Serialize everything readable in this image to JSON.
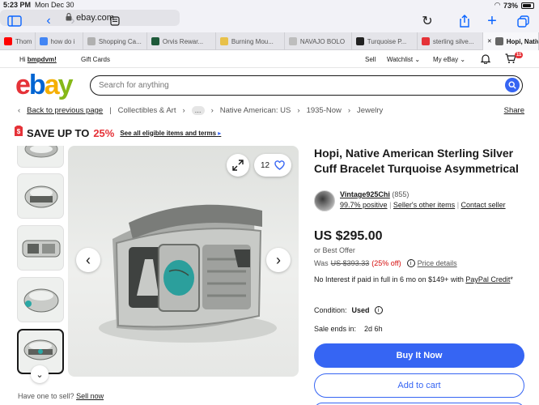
{
  "status_bar": {
    "time": "5:23 PM",
    "date": "Mon Dec 30",
    "battery": "73%"
  },
  "browser": {
    "url": "ebay.com",
    "tabs": [
      {
        "label": "Thom",
        "color": "#ff0000"
      },
      {
        "label": "how do i",
        "color": "#4285f4"
      },
      {
        "label": "Shopping Ca...",
        "color": "#b0b0b0"
      },
      {
        "label": "Orvis Rewar...",
        "color": "#1e5a3a"
      },
      {
        "label": "Burning Mou...",
        "color": "#e8c14a"
      },
      {
        "label": "NAVAJO BOLO",
        "color": "#bdbdbd"
      },
      {
        "label": "Turquoise P...",
        "color": "#222222"
      },
      {
        "label": "sterling silve...",
        "color": "#e53238"
      },
      {
        "label": "Hopi, Native...",
        "color": "#666666"
      }
    ]
  },
  "top_links": {
    "greeting": "Hi",
    "username": "bmpdvm!",
    "gift_cards": "Gift Cards",
    "sell": "Sell",
    "watchlist": "Watchlist",
    "my_ebay": "My eBay",
    "cart_count": "11"
  },
  "search": {
    "placeholder": "Search for anything"
  },
  "breadcrumb": {
    "back": "Back to previous page",
    "items": [
      "Collectibles & Art",
      "...",
      "Native American: US",
      "1935-Now",
      "Jewelry"
    ],
    "share": "Share"
  },
  "promo": {
    "prefix": "SAVE UP TO",
    "percent": "25%",
    "link": "See all eligible items and terms"
  },
  "gallery": {
    "watch_count": "12",
    "total_thumbs": 5,
    "selected_thumb": 5
  },
  "listing": {
    "title": "Hopi, Native American Sterling Silver Cuff Bracelet Turquoise Asymmetrical",
    "seller_name": "Vintage925Chi",
    "seller_feedback": "(855)",
    "positive": "99.7% positive",
    "other_items": "Seller's other items",
    "contact": "Contact seller",
    "price": "US $295.00",
    "best_offer": "or Best Offer",
    "was_label": "Was",
    "was_price": "US $393.33",
    "discount": "(25% off)",
    "price_details": "Price details",
    "financing_text": "No Interest if paid in full in 6 mo on $149+ with",
    "paypal_credit": "PayPal Credit",
    "financing_suffix": "*",
    "condition_label": "Condition:",
    "condition_value": "Used",
    "sale_ends_label": "Sale ends in:",
    "sale_ends_value": "2d 6h",
    "buy_now": "Buy It Now",
    "add_to_cart": "Add to cart"
  },
  "sell_prompt": {
    "text": "Have one to sell?",
    "link": "Sell now"
  },
  "colors": {
    "ebay_blue": "#3665f3",
    "ebay_red": "#e53238",
    "ebay_yellow": "#f5af02",
    "ebay_green": "#86b817",
    "discount_red": "#d50b0b",
    "link_blue": "#3665f3"
  }
}
